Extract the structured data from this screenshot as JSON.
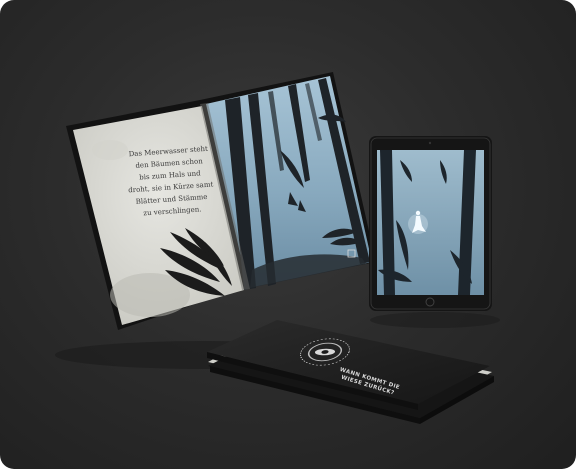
{
  "book": {
    "text_lines": [
      "Das Meerwasser steht",
      "den Bäumen schon",
      "bis zum Hals und",
      "droht, sie in Kürze samt",
      "Blätter und Stämme",
      "zu verschlingen."
    ]
  },
  "closed_book": {
    "title_lines": [
      "WANN KOMMT DIE",
      "WIESE ZURÜCK?"
    ]
  },
  "colors": {
    "background": "#2c2c2c",
    "book_page": "#dcdcd6",
    "forest_blue": "#8fb0c4",
    "device_frame": "#1a1a1a"
  }
}
